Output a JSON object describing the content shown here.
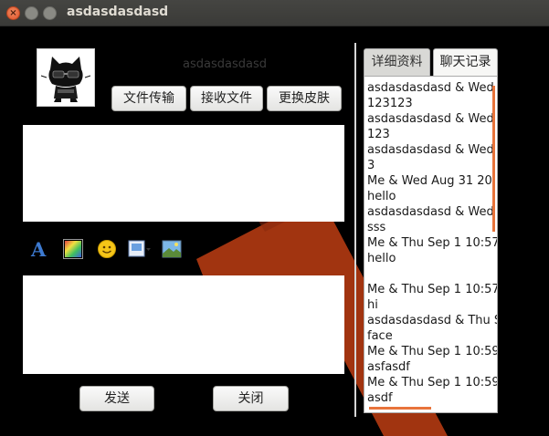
{
  "window": {
    "title": "asdasdasdasd"
  },
  "peer": {
    "name": "asdasdasdasd"
  },
  "toolbar": {
    "file_transfer": "文件传输",
    "receive_file": "接收文件",
    "change_skin": "更换皮肤"
  },
  "actions": {
    "send": "发送",
    "close": "关闭"
  },
  "tabs": [
    {
      "label": "详细资料",
      "active": false
    },
    {
      "label": "聊天记录",
      "active": true
    }
  ],
  "history_lines": [
    "asdasdasdasd & Wed",
    "123123",
    "asdasdasdasd & Wed",
    "123",
    "asdasdasdasd & Wed",
    "3",
    "Me & Wed Aug 31 20:",
    "hello",
    "asdasdasdasd & Wed",
    "sss",
    "Me & Thu Sep  1 10:57",
    "hello",
    "",
    "Me & Thu Sep  1 10:57",
    "hi",
    "asdasdasdasd & Thu S",
    "face",
    "Me & Thu Sep  1 10:59",
    "asfasdf",
    "Me & Thu Sep  1 10:59",
    "asdf"
  ],
  "format_tools": [
    "font-icon",
    "color-icon",
    "emoji-icon",
    "screenshot-icon",
    "image-icon"
  ],
  "colors": {
    "accent": "#e8743b",
    "close_button": "#e0522a",
    "titlebar": "#3c3b37"
  }
}
